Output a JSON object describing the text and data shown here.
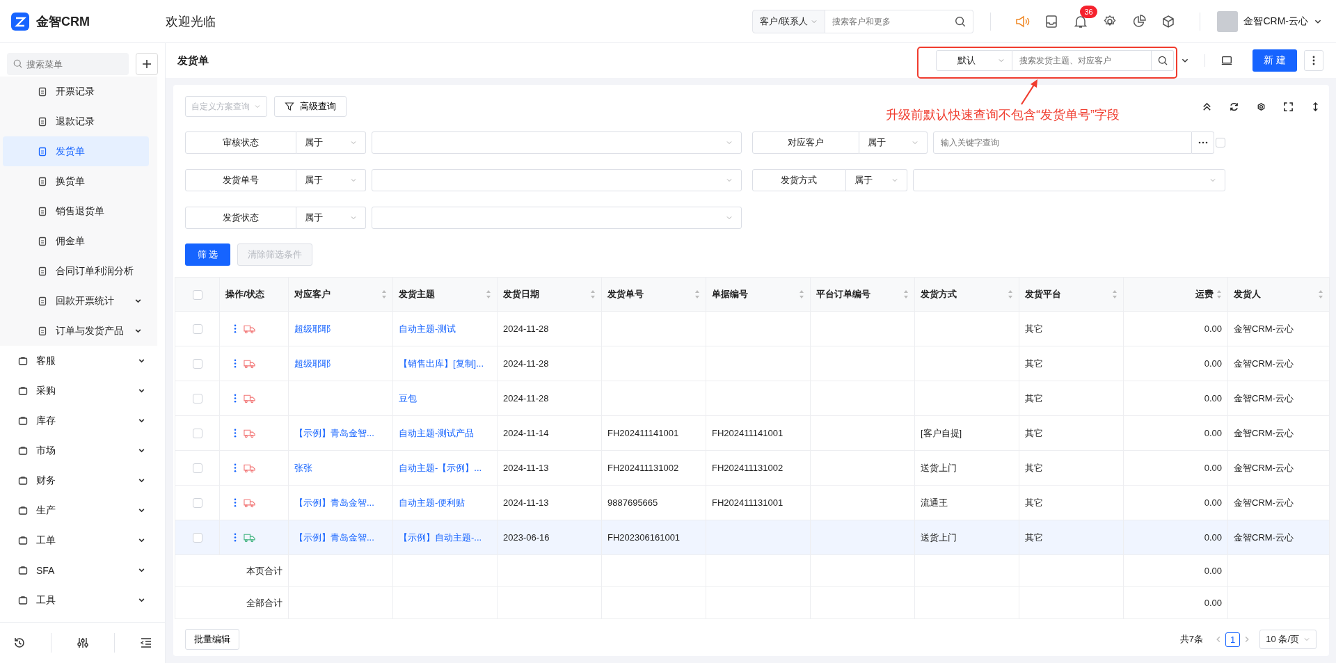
{
  "topbar": {
    "logo": "金智CRM",
    "welcome": "欢迎光临",
    "search_scope": "客户/联系人",
    "search_placeholder": "搜索客户和更多",
    "badge": "36",
    "user": "金智CRM-云心"
  },
  "sidebar": {
    "search_placeholder": "搜索菜单",
    "submenu": [
      {
        "label": "开票记录",
        "selected": false,
        "expandable": false
      },
      {
        "label": "退款记录",
        "selected": false,
        "expandable": false
      },
      {
        "label": "发货单",
        "selected": true,
        "expandable": false
      },
      {
        "label": "换货单",
        "selected": false,
        "expandable": false
      },
      {
        "label": "销售退货单",
        "selected": false,
        "expandable": false
      },
      {
        "label": "佣金单",
        "selected": false,
        "expandable": false
      },
      {
        "label": "合同订单利润分析",
        "selected": false,
        "expandable": false
      },
      {
        "label": "回款开票统计",
        "selected": false,
        "expandable": true
      },
      {
        "label": "订单与发货产品",
        "selected": false,
        "expandable": true
      }
    ],
    "menu": [
      {
        "label": "客服"
      },
      {
        "label": "采购"
      },
      {
        "label": "库存"
      },
      {
        "label": "市场"
      },
      {
        "label": "财务"
      },
      {
        "label": "生产"
      },
      {
        "label": "工单"
      },
      {
        "label": "SFA"
      },
      {
        "label": "工具"
      }
    ]
  },
  "page": {
    "title": "发货单",
    "view": "默认",
    "search_placeholder": "搜索发货主题、对应客户",
    "new_button": "新 建"
  },
  "annotation": "升级前默认快速查询不包含“发货单号”字段",
  "filter": {
    "scheme_placeholder": "自定义方案查询",
    "advanced": "高级查询",
    "fields": [
      {
        "label": "审核状态",
        "operator": "属于",
        "kind": "select"
      },
      {
        "label": "对应客户",
        "operator": "属于",
        "kind": "input",
        "placeholder": "输入关键字查询",
        "checked": false
      },
      {
        "label": "发货单号",
        "operator": "属于",
        "kind": "select"
      },
      {
        "label": "发货方式",
        "operator": "属于",
        "kind": "select"
      },
      {
        "label": "发货状态",
        "operator": "属于",
        "kind": "select"
      }
    ],
    "apply": "筛 选",
    "clear": "清除筛选条件",
    "clear_disabled": true
  },
  "table": {
    "all_checked": false,
    "columns": [
      {
        "label": "操作/状态",
        "kind": "action",
        "sortable": false
      },
      {
        "label": "对应客户",
        "kind": "link",
        "sortable": true
      },
      {
        "label": "发货主题",
        "kind": "link",
        "sortable": true
      },
      {
        "label": "发货日期",
        "kind": "text",
        "sortable": true
      },
      {
        "label": "发货单号",
        "kind": "text",
        "sortable": true
      },
      {
        "label": "单据编号",
        "kind": "text",
        "sortable": true
      },
      {
        "label": "平台订单编号",
        "kind": "text",
        "sortable": true
      },
      {
        "label": "发货方式",
        "kind": "text",
        "sortable": true
      },
      {
        "label": "发货平台",
        "kind": "text",
        "sortable": true
      },
      {
        "label": "运费",
        "kind": "number",
        "sortable": true
      },
      {
        "label": "发货人",
        "kind": "text",
        "sortable": true
      }
    ],
    "rows": [
      {
        "checked": false,
        "hovered": false,
        "color": "#f27474",
        "cells": [
          "",
          "超级耶耶",
          "自动主题-测试",
          "2024-11-28",
          "",
          "",
          "",
          "",
          "其它",
          "0.00",
          "金智CRM-云心"
        ]
      },
      {
        "checked": false,
        "hovered": false,
        "color": "#f27474",
        "cells": [
          "",
          "超级耶耶",
          "【销售出库】[复制]...",
          "2024-11-28",
          "",
          "",
          "",
          "",
          "其它",
          "0.00",
          "金智CRM-云心"
        ]
      },
      {
        "checked": false,
        "hovered": false,
        "color": "#f27474",
        "cells": [
          "",
          "",
          "豆包",
          "2024-11-28",
          "",
          "",
          "",
          "",
          "其它",
          "0.00",
          "金智CRM-云心"
        ]
      },
      {
        "checked": false,
        "hovered": false,
        "color": "#f27474",
        "cells": [
          "",
          "【示例】青岛金智...",
          "自动主题-测试产品",
          "2024-11-14",
          "FH202411141001",
          "FH202411141001",
          "",
          "[客户自提]",
          "其它",
          "0.00",
          "金智CRM-云心"
        ]
      },
      {
        "checked": false,
        "hovered": false,
        "color": "#f27474",
        "cells": [
          "",
          "张张",
          "自动主题-【示例】...",
          "2024-11-13",
          "FH202411131002",
          "FH202411131002",
          "",
          "送货上门",
          "其它",
          "0.00",
          "金智CRM-云心"
        ]
      },
      {
        "checked": false,
        "hovered": false,
        "color": "#f27474",
        "cells": [
          "",
          "【示例】青岛金智...",
          "自动主题-便利贴",
          "2024-11-13",
          "9887695665",
          "FH202411131001",
          "",
          "流通王",
          "其它",
          "0.00",
          "金智CRM-云心"
        ]
      },
      {
        "checked": false,
        "hovered": true,
        "color": "#3fb37f",
        "cells": [
          "",
          "【示例】青岛金智...",
          "【示例】自动主题-...",
          "2023-06-16",
          "FH202306161001",
          "",
          "",
          "送货上门",
          "其它",
          "0.00",
          "金智CRM-云心"
        ]
      }
    ],
    "summary": [
      {
        "cells": [
          "本页合计",
          "",
          "",
          "",
          "",
          "",
          "",
          "",
          "",
          "0.00",
          ""
        ]
      },
      {
        "cells": [
          "全部合计",
          "",
          "",
          "",
          "",
          "",
          "",
          "",
          "",
          "0.00",
          ""
        ]
      }
    ]
  },
  "footer": {
    "batch_edit": "批量编辑",
    "total": "共7条",
    "page": "1",
    "page_size": "10 条/页"
  }
}
